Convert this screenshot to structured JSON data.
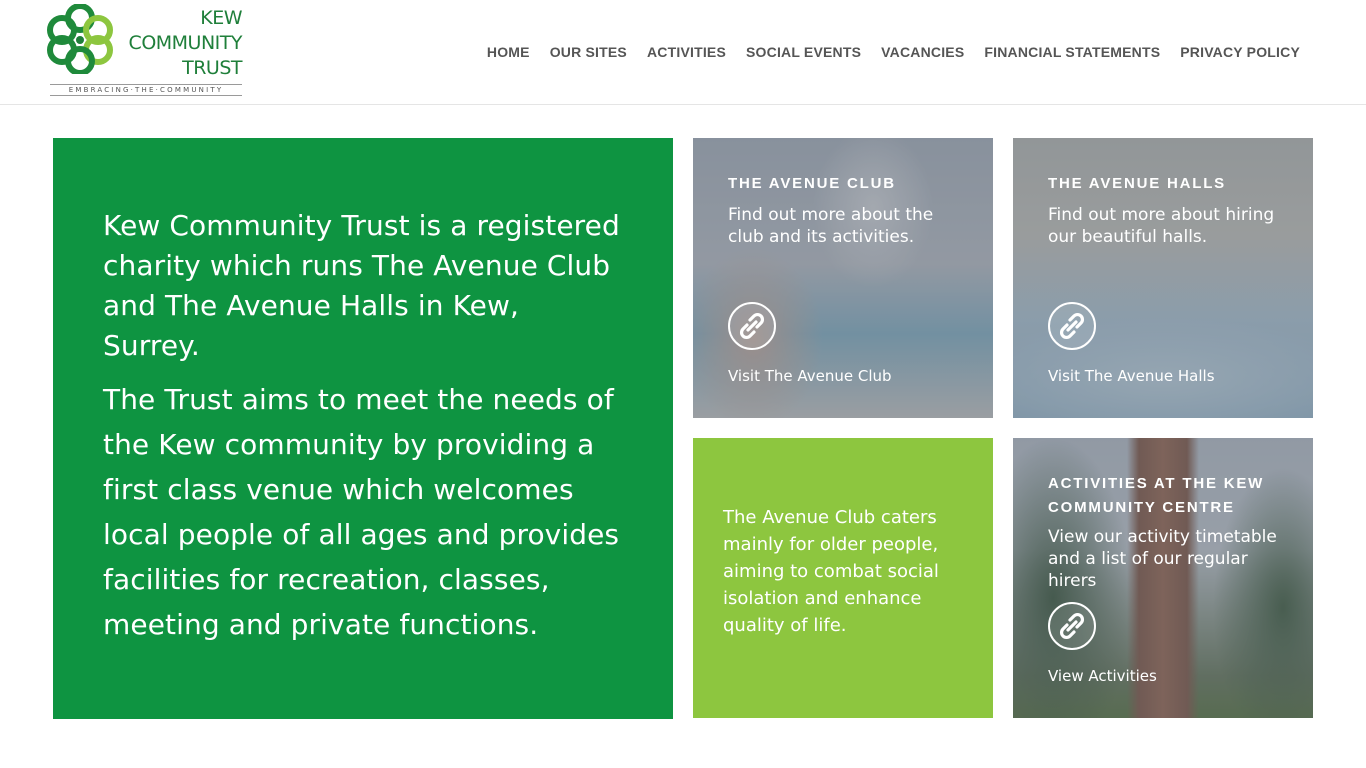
{
  "brand": {
    "name_lines": [
      "KEW",
      "COMMUNITY",
      "TRUST"
    ],
    "tagline": "EMBRACING·THE·COMMUNITY",
    "green": "#0e9441",
    "lime": "#8dc63f",
    "dark_green": "#1f7f3a"
  },
  "nav": {
    "items": [
      {
        "label": "HOME"
      },
      {
        "label": "OUR SITES"
      },
      {
        "label": "ACTIVITIES"
      },
      {
        "label": "SOCIAL EVENTS"
      },
      {
        "label": "VACANCIES"
      },
      {
        "label": "FINANCIAL STATEMENTS"
      },
      {
        "label": "PRIVACY POLICY"
      }
    ]
  },
  "intro": {
    "paragraph1": "Kew Community Trust is a registered charity which runs The Avenue Club and The Avenue Halls in Kew, Surrey.",
    "paragraph2": "The Trust aims to meet the needs of the Kew community by providing a first class venue which welcomes local people of all ages and provides facilities for recreation, classes, meeting and private functions."
  },
  "cards": [
    {
      "title": "THE AVENUE CLUB",
      "description": "Find out more about the club and its activities.",
      "icon": "link-icon",
      "link_label": "Visit The Avenue Club"
    },
    {
      "title": "THE AVENUE HALLS",
      "description": "Find out more about hiring our beautiful halls.",
      "icon": "link-icon",
      "link_label": "Visit The Avenue Halls"
    },
    {
      "title": "ACTIVITIES AT THE KEW COMMUNITY CENTRE",
      "description": "View our activity timetable and a list of our regular hirers",
      "icon": "link-icon",
      "link_label": "View Activities"
    }
  ],
  "club_info": {
    "text": "The Avenue Club caters mainly for older people, aiming to combat social isolation and enhance quality of life."
  }
}
